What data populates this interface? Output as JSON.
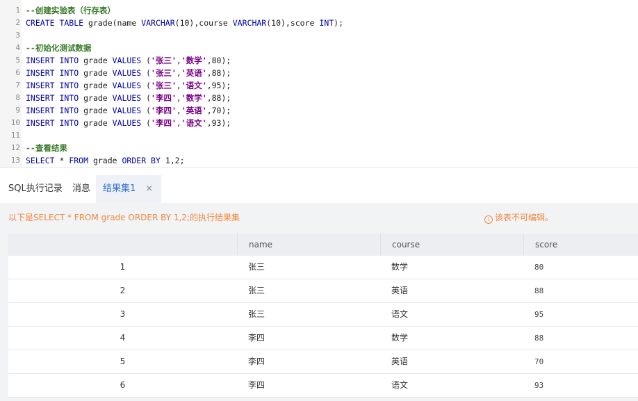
{
  "editor": {
    "lines": [
      {
        "n": "1",
        "tokens": [
          {
            "t": "--创建实验表（行存表）",
            "c": "cmt"
          }
        ]
      },
      {
        "n": "2",
        "tokens": [
          {
            "t": "CREATE TABLE",
            "c": "kw"
          },
          {
            "t": " grade(name ",
            "c": "plain"
          },
          {
            "t": "VARCHAR",
            "c": "kw"
          },
          {
            "t": "(10),course ",
            "c": "plain"
          },
          {
            "t": "VARCHAR",
            "c": "kw"
          },
          {
            "t": "(10),score ",
            "c": "plain"
          },
          {
            "t": "INT",
            "c": "kw"
          },
          {
            "t": ");",
            "c": "plain"
          }
        ]
      },
      {
        "n": "3",
        "tokens": []
      },
      {
        "n": "4",
        "tokens": [
          {
            "t": "--初始化测试数据",
            "c": "cmt"
          }
        ]
      },
      {
        "n": "5",
        "tokens": [
          {
            "t": "INSERT INTO",
            "c": "kw"
          },
          {
            "t": " grade ",
            "c": "plain"
          },
          {
            "t": "VALUES",
            "c": "kw"
          },
          {
            "t": " (",
            "c": "plain"
          },
          {
            "t": "'张三'",
            "c": "str"
          },
          {
            "t": ",",
            "c": "plain"
          },
          {
            "t": "'数学'",
            "c": "str"
          },
          {
            "t": ",80);",
            "c": "plain"
          }
        ]
      },
      {
        "n": "6",
        "tokens": [
          {
            "t": "INSERT INTO",
            "c": "kw"
          },
          {
            "t": " grade ",
            "c": "plain"
          },
          {
            "t": "VALUES",
            "c": "kw"
          },
          {
            "t": " (",
            "c": "plain"
          },
          {
            "t": "'张三'",
            "c": "str"
          },
          {
            "t": ",",
            "c": "plain"
          },
          {
            "t": "'英语'",
            "c": "str"
          },
          {
            "t": ",88);",
            "c": "plain"
          }
        ]
      },
      {
        "n": "7",
        "tokens": [
          {
            "t": "INSERT INTO",
            "c": "kw"
          },
          {
            "t": " grade ",
            "c": "plain"
          },
          {
            "t": "VALUES",
            "c": "kw"
          },
          {
            "t": " (",
            "c": "plain"
          },
          {
            "t": "'张三'",
            "c": "str"
          },
          {
            "t": ",",
            "c": "plain"
          },
          {
            "t": "'语文'",
            "c": "str"
          },
          {
            "t": ",95);",
            "c": "plain"
          }
        ]
      },
      {
        "n": "8",
        "tokens": [
          {
            "t": "INSERT INTO",
            "c": "kw"
          },
          {
            "t": " grade ",
            "c": "plain"
          },
          {
            "t": "VALUES",
            "c": "kw"
          },
          {
            "t": " (",
            "c": "plain"
          },
          {
            "t": "'李四'",
            "c": "str"
          },
          {
            "t": ",",
            "c": "plain"
          },
          {
            "t": "'数学'",
            "c": "str"
          },
          {
            "t": ",88);",
            "c": "plain"
          }
        ]
      },
      {
        "n": "9",
        "tokens": [
          {
            "t": "INSERT INTO",
            "c": "kw"
          },
          {
            "t": " grade ",
            "c": "plain"
          },
          {
            "t": "VALUES",
            "c": "kw"
          },
          {
            "t": " (",
            "c": "plain"
          },
          {
            "t": "'李四'",
            "c": "str"
          },
          {
            "t": ",",
            "c": "plain"
          },
          {
            "t": "'英语'",
            "c": "str"
          },
          {
            "t": ",70);",
            "c": "plain"
          }
        ]
      },
      {
        "n": "10",
        "tokens": [
          {
            "t": "INSERT INTO",
            "c": "kw"
          },
          {
            "t": " grade ",
            "c": "plain"
          },
          {
            "t": "VALUES",
            "c": "kw"
          },
          {
            "t": " (",
            "c": "plain"
          },
          {
            "t": "'李四'",
            "c": "str"
          },
          {
            "t": ",",
            "c": "plain"
          },
          {
            "t": "'语文'",
            "c": "str"
          },
          {
            "t": ",93);",
            "c": "plain"
          }
        ]
      },
      {
        "n": "11",
        "tokens": []
      },
      {
        "n": "12",
        "tokens": [
          {
            "t": "--查看结果",
            "c": "cmt"
          }
        ]
      },
      {
        "n": "13",
        "tokens": [
          {
            "t": "SELECT",
            "c": "kw"
          },
          {
            "t": " * ",
            "c": "plain"
          },
          {
            "t": "FROM",
            "c": "kw"
          },
          {
            "t": " grade ",
            "c": "plain"
          },
          {
            "t": "ORDER BY",
            "c": "kw"
          },
          {
            "t": " 1,2;",
            "c": "plain"
          }
        ]
      }
    ]
  },
  "tabs": {
    "history": "SQL执行记录",
    "messages": "消息",
    "result": "结果集1",
    "close_glyph": "×"
  },
  "result": {
    "summary": "以下是SELECT * FROM grade ORDER BY 1,2;的执行结果集",
    "readonly_icon": "i",
    "readonly": "该表不可编辑。",
    "columns": [
      "",
      "name",
      "course",
      "score"
    ],
    "rows": [
      [
        "1",
        "张三",
        "数学",
        "80"
      ],
      [
        "2",
        "张三",
        "英语",
        "88"
      ],
      [
        "3",
        "张三",
        "语文",
        "95"
      ],
      [
        "4",
        "李四",
        "数学",
        "88"
      ],
      [
        "5",
        "李四",
        "英语",
        "70"
      ],
      [
        "6",
        "李四",
        "语文",
        "93"
      ]
    ]
  },
  "colors": {
    "accent": "#2f6fd6",
    "warning": "#f0883e",
    "keyword": "#0000a8",
    "string": "#7a008a",
    "comment": "#3a7a2a"
  }
}
